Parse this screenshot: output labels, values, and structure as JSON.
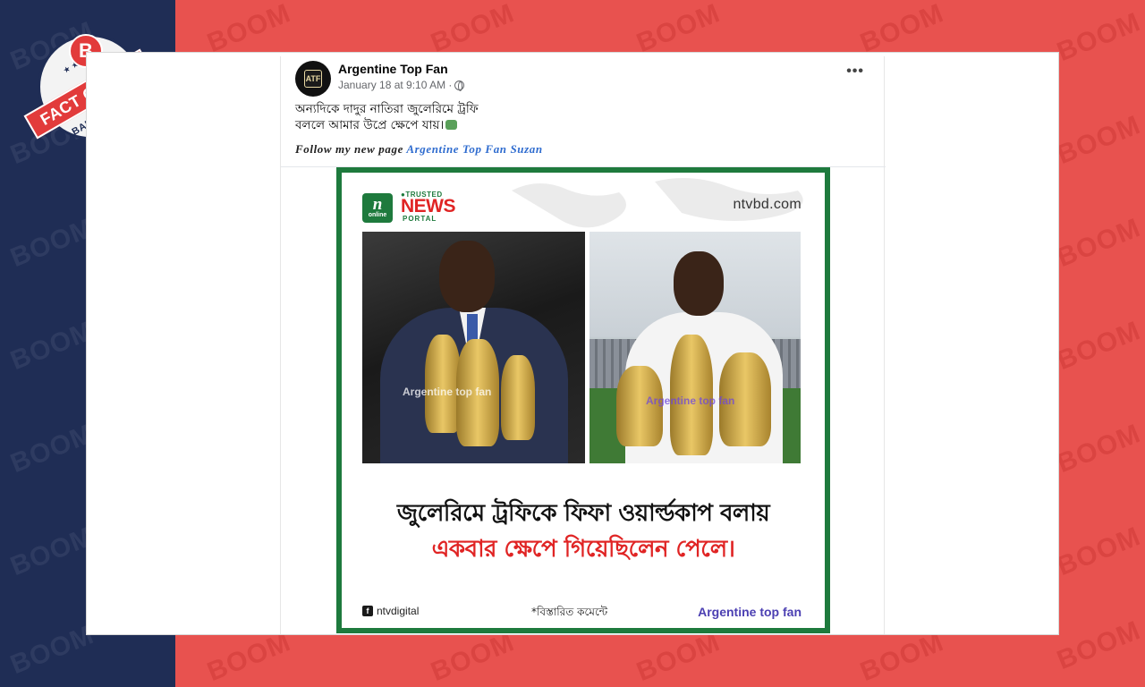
{
  "badge": {
    "letter": "B",
    "label": "FACT CHECK",
    "country": "BANGLADESH",
    "stars": "★ ★ ★ ★ ★"
  },
  "watermark": "BOOM",
  "post": {
    "page_name": "Argentine Top Fan",
    "timestamp": "January 18 at 9:10 AM ·",
    "more_label": "•••",
    "caption_line1": "অন্যদিকে দাদুর নাতিরা জুলেরিমে ট্রফি",
    "caption_line2": "বললে আমার উপ্রে ক্ষেপে যায়।",
    "follow_prefix": "Follow my new page",
    "follow_link": "Argentine Top Fan Suzan",
    "avatar_text": "ATF"
  },
  "shared_image": {
    "logo_n": "n",
    "logo_sub": "online",
    "trusted": "●TRUSTED",
    "news": "NEWS",
    "portal": "PORTAL",
    "site": "ntvbd.com",
    "watermark_left": "Argentine top fan",
    "watermark_right": "Argentine top fan",
    "headline_line1": "জুলেরিমে ট্রফিকে ফিফা ওয়ার্ল্ডকাপ বলায়",
    "headline_line2": "একবার ক্ষেপে গিয়েছিলেন পেলে।",
    "footer_fb_icon": "f",
    "footer_handle": "ntvdigital",
    "footer_detail": "*বিস্তারিত কমেন্টে",
    "footer_brand": "Argentine top fan"
  },
  "colors": {
    "left_panel": "#1f2d55",
    "right_panel": "#e8524f",
    "frame_green": "#1e7a3d",
    "news_red": "#e02424",
    "link_blue": "#2f6ccf",
    "brand_purple": "#4b3fb2"
  }
}
